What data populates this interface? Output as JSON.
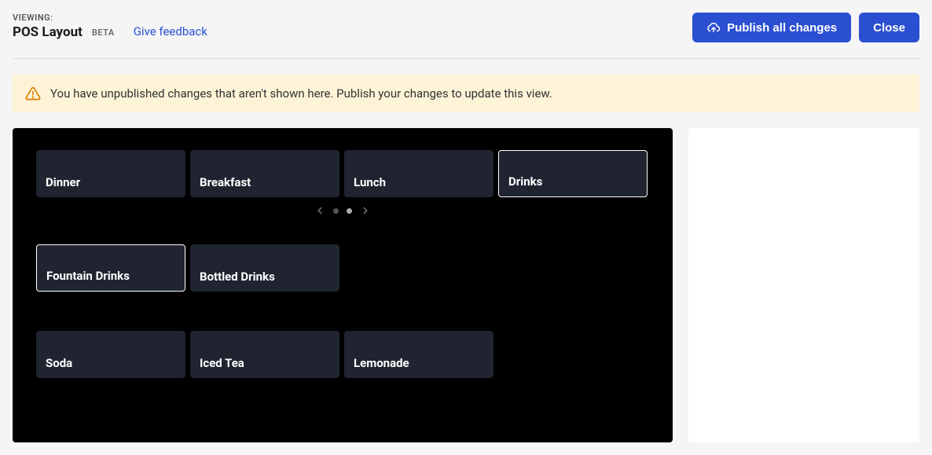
{
  "header": {
    "viewing_label": "VIEWING:",
    "title": "POS Layout",
    "beta": "BETA",
    "feedback": "Give feedback",
    "publish_btn": "Publish all changes",
    "close_btn": "Close"
  },
  "alert": {
    "message": "You have unpublished changes that aren't shown here. Publish your changes to update this view."
  },
  "pos": {
    "categories": [
      {
        "label": "Dinner",
        "selected": false
      },
      {
        "label": "Breakfast",
        "selected": false
      },
      {
        "label": "Lunch",
        "selected": false
      },
      {
        "label": "Drinks",
        "selected": true
      }
    ],
    "subcategories": [
      {
        "label": "Fountain Drinks",
        "selected": true
      },
      {
        "label": "Bottled Drinks",
        "selected": false
      }
    ],
    "items": [
      {
        "label": "Soda"
      },
      {
        "label": "Iced Tea"
      },
      {
        "label": "Lemonade"
      }
    ]
  }
}
